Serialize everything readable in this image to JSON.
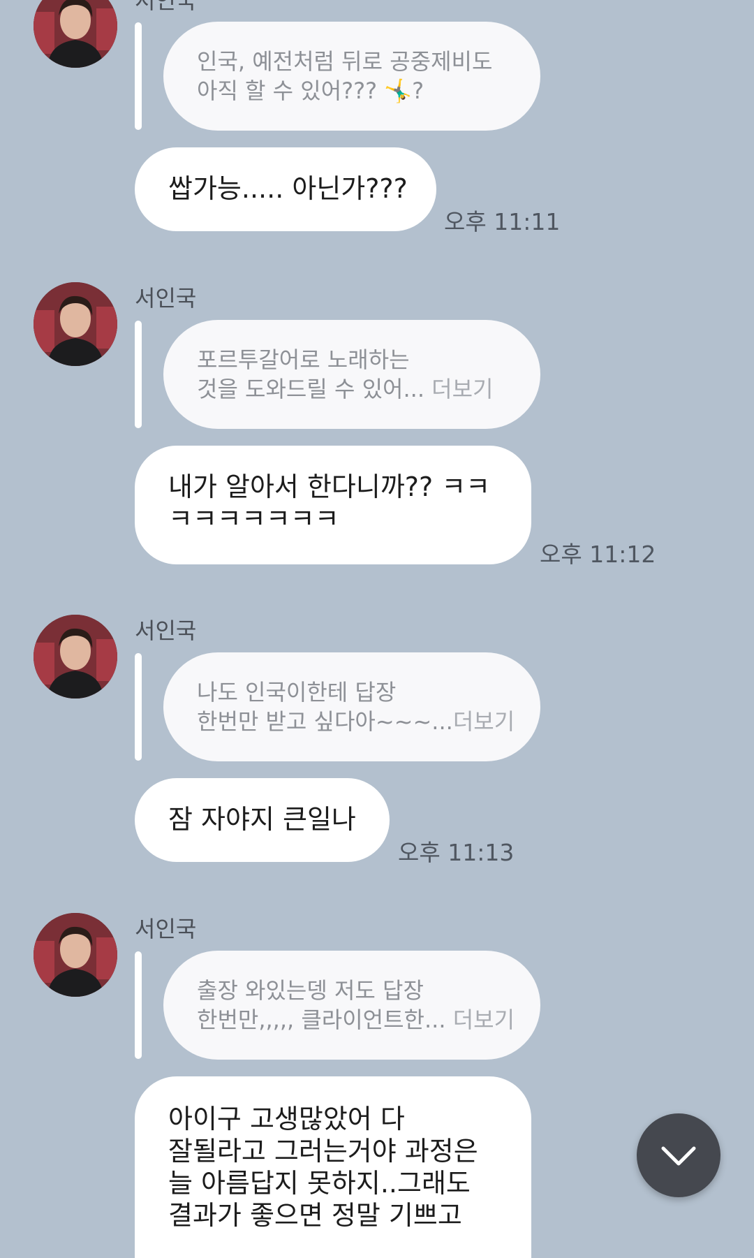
{
  "messages": [
    {
      "sender": "서인국",
      "quote_lines": [
        "인국, 예전처럼 뒤로 공중제비도",
        "아직 할 수 있어??? 🤸‍♂️?"
      ],
      "quote_more": "",
      "reply_lines": [
        "쌉가능..... 아닌가???"
      ],
      "time": "오후 11:11"
    },
    {
      "sender": "서인국",
      "quote_lines": [
        "포르투갈어로 노래하는",
        "것을 도와드릴 수 있어..."
      ],
      "quote_more": "더보기",
      "reply_lines": [
        "내가 알아서 한다니까?? ㅋㅋ",
        "ㅋㅋㅋㅋㅋㅋㅋ"
      ],
      "time": "오후 11:12"
    },
    {
      "sender": "서인국",
      "quote_lines": [
        "나도 인국이한테 답장",
        "한번만 받고 싶다아~~~..."
      ],
      "quote_more": "더보기",
      "reply_lines": [
        "잠 자야지 큰일나"
      ],
      "time": "오후 11:13"
    },
    {
      "sender": "서인국",
      "quote_lines": [
        "출장 와있는뎅 저도 답장",
        "한번만,,,,, 클라이언트한..."
      ],
      "quote_more": "더보기",
      "reply_lines": [
        "아이구 고생많았어 다",
        "잘될라고 그러는거야 과정은",
        "늘 아름답지 못하지..그래도",
        "결과가 좋으면 정말 기쁘고"
      ],
      "time": ""
    }
  ],
  "icons": {
    "avatar": "profile-photo",
    "scroll": "chevron-down-icon"
  },
  "colors": {
    "background": "#b3c0ce",
    "bubble": "#ffffff",
    "quote_bubble": "#f8f8fa",
    "scroll_button": "#45484f"
  }
}
